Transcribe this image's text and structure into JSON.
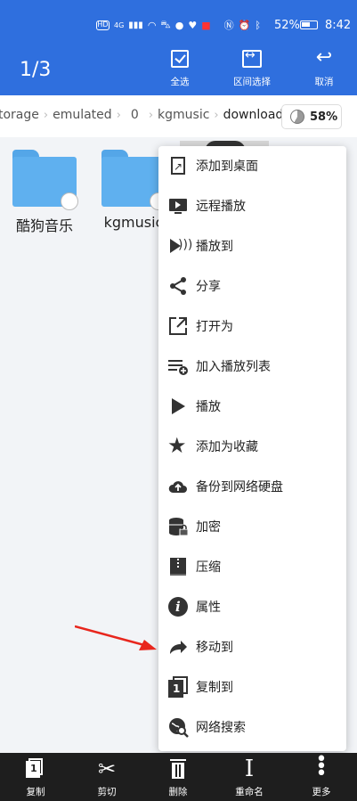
{
  "status_bar": {
    "left_badges": [
      "HD",
      "4G",
      "📶",
      "WiFi",
      "🚗",
      "💬",
      "♡",
      "▣"
    ],
    "battery": "52%",
    "time": "8:42"
  },
  "header": {
    "title": "1/3",
    "actions": [
      {
        "label": "全选",
        "icon": "checkbox-icon"
      },
      {
        "label": "区间选择",
        "icon": "range-select-icon"
      },
      {
        "label": "取消",
        "icon": "undo-icon"
      }
    ]
  },
  "breadcrumb": {
    "items": [
      "torage",
      "emulated",
      "0",
      "kgmusic",
      "download"
    ],
    "storage_percent": "58%"
  },
  "files": [
    {
      "name": "酷狗音乐"
    },
    {
      "name": "kgmusic"
    }
  ],
  "context_menu": {
    "items": [
      {
        "label": "添加到桌面",
        "icon": "add-to-desktop-icon"
      },
      {
        "label": "远程播放",
        "icon": "remote-play-icon"
      },
      {
        "label": "播放到",
        "icon": "cast-icon"
      },
      {
        "label": "分享",
        "icon": "share-icon"
      },
      {
        "label": "打开为",
        "icon": "open-as-icon"
      },
      {
        "label": "加入播放列表",
        "icon": "add-playlist-icon"
      },
      {
        "label": "播放",
        "icon": "play-icon"
      },
      {
        "label": "添加为收藏",
        "icon": "star-icon"
      },
      {
        "label": "备份到网络硬盘",
        "icon": "cloud-upload-icon"
      },
      {
        "label": "加密",
        "icon": "encrypt-icon"
      },
      {
        "label": "压缩",
        "icon": "compress-icon"
      },
      {
        "label": "属性",
        "icon": "info-icon"
      },
      {
        "label": "移动到",
        "icon": "move-icon"
      },
      {
        "label": "复制到",
        "icon": "copy-to-icon"
      },
      {
        "label": "网络搜索",
        "icon": "web-search-icon"
      }
    ]
  },
  "bottom_bar": {
    "items": [
      {
        "label": "复制",
        "icon": "copy-icon"
      },
      {
        "label": "剪切",
        "icon": "cut-icon"
      },
      {
        "label": "删除",
        "icon": "delete-icon"
      },
      {
        "label": "重命名",
        "icon": "rename-icon"
      },
      {
        "label": "更多",
        "icon": "more-icon"
      }
    ]
  },
  "colors": {
    "primary": "#2f6fde",
    "bottom_bar": "#1e1e1e",
    "folder": "#5fb0ef",
    "annotation_arrow": "#e8261d"
  }
}
